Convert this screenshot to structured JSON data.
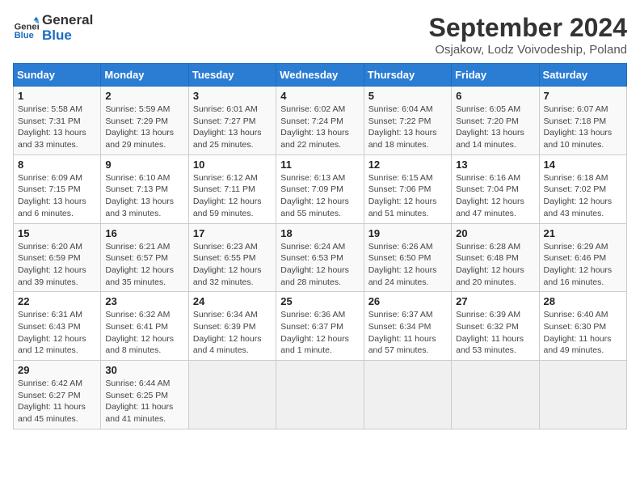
{
  "logo": {
    "text_general": "General",
    "text_blue": "Blue"
  },
  "title": "September 2024",
  "subtitle": "Osjakow, Lodz Voivodeship, Poland",
  "weekdays": [
    "Sunday",
    "Monday",
    "Tuesday",
    "Wednesday",
    "Thursday",
    "Friday",
    "Saturday"
  ],
  "weeks": [
    [
      {
        "day": "1",
        "info": "Sunrise: 5:58 AM\nSunset: 7:31 PM\nDaylight: 13 hours\nand 33 minutes."
      },
      {
        "day": "2",
        "info": "Sunrise: 5:59 AM\nSunset: 7:29 PM\nDaylight: 13 hours\nand 29 minutes."
      },
      {
        "day": "3",
        "info": "Sunrise: 6:01 AM\nSunset: 7:27 PM\nDaylight: 13 hours\nand 25 minutes."
      },
      {
        "day": "4",
        "info": "Sunrise: 6:02 AM\nSunset: 7:24 PM\nDaylight: 13 hours\nand 22 minutes."
      },
      {
        "day": "5",
        "info": "Sunrise: 6:04 AM\nSunset: 7:22 PM\nDaylight: 13 hours\nand 18 minutes."
      },
      {
        "day": "6",
        "info": "Sunrise: 6:05 AM\nSunset: 7:20 PM\nDaylight: 13 hours\nand 14 minutes."
      },
      {
        "day": "7",
        "info": "Sunrise: 6:07 AM\nSunset: 7:18 PM\nDaylight: 13 hours\nand 10 minutes."
      }
    ],
    [
      {
        "day": "8",
        "info": "Sunrise: 6:09 AM\nSunset: 7:15 PM\nDaylight: 13 hours\nand 6 minutes."
      },
      {
        "day": "9",
        "info": "Sunrise: 6:10 AM\nSunset: 7:13 PM\nDaylight: 13 hours\nand 3 minutes."
      },
      {
        "day": "10",
        "info": "Sunrise: 6:12 AM\nSunset: 7:11 PM\nDaylight: 12 hours\nand 59 minutes."
      },
      {
        "day": "11",
        "info": "Sunrise: 6:13 AM\nSunset: 7:09 PM\nDaylight: 12 hours\nand 55 minutes."
      },
      {
        "day": "12",
        "info": "Sunrise: 6:15 AM\nSunset: 7:06 PM\nDaylight: 12 hours\nand 51 minutes."
      },
      {
        "day": "13",
        "info": "Sunrise: 6:16 AM\nSunset: 7:04 PM\nDaylight: 12 hours\nand 47 minutes."
      },
      {
        "day": "14",
        "info": "Sunrise: 6:18 AM\nSunset: 7:02 PM\nDaylight: 12 hours\nand 43 minutes."
      }
    ],
    [
      {
        "day": "15",
        "info": "Sunrise: 6:20 AM\nSunset: 6:59 PM\nDaylight: 12 hours\nand 39 minutes."
      },
      {
        "day": "16",
        "info": "Sunrise: 6:21 AM\nSunset: 6:57 PM\nDaylight: 12 hours\nand 35 minutes."
      },
      {
        "day": "17",
        "info": "Sunrise: 6:23 AM\nSunset: 6:55 PM\nDaylight: 12 hours\nand 32 minutes."
      },
      {
        "day": "18",
        "info": "Sunrise: 6:24 AM\nSunset: 6:53 PM\nDaylight: 12 hours\nand 28 minutes."
      },
      {
        "day": "19",
        "info": "Sunrise: 6:26 AM\nSunset: 6:50 PM\nDaylight: 12 hours\nand 24 minutes."
      },
      {
        "day": "20",
        "info": "Sunrise: 6:28 AM\nSunset: 6:48 PM\nDaylight: 12 hours\nand 20 minutes."
      },
      {
        "day": "21",
        "info": "Sunrise: 6:29 AM\nSunset: 6:46 PM\nDaylight: 12 hours\nand 16 minutes."
      }
    ],
    [
      {
        "day": "22",
        "info": "Sunrise: 6:31 AM\nSunset: 6:43 PM\nDaylight: 12 hours\nand 12 minutes."
      },
      {
        "day": "23",
        "info": "Sunrise: 6:32 AM\nSunset: 6:41 PM\nDaylight: 12 hours\nand 8 minutes."
      },
      {
        "day": "24",
        "info": "Sunrise: 6:34 AM\nSunset: 6:39 PM\nDaylight: 12 hours\nand 4 minutes."
      },
      {
        "day": "25",
        "info": "Sunrise: 6:36 AM\nSunset: 6:37 PM\nDaylight: 12 hours\nand 1 minute."
      },
      {
        "day": "26",
        "info": "Sunrise: 6:37 AM\nSunset: 6:34 PM\nDaylight: 11 hours\nand 57 minutes."
      },
      {
        "day": "27",
        "info": "Sunrise: 6:39 AM\nSunset: 6:32 PM\nDaylight: 11 hours\nand 53 minutes."
      },
      {
        "day": "28",
        "info": "Sunrise: 6:40 AM\nSunset: 6:30 PM\nDaylight: 11 hours\nand 49 minutes."
      }
    ],
    [
      {
        "day": "29",
        "info": "Sunrise: 6:42 AM\nSunset: 6:27 PM\nDaylight: 11 hours\nand 45 minutes."
      },
      {
        "day": "30",
        "info": "Sunrise: 6:44 AM\nSunset: 6:25 PM\nDaylight: 11 hours\nand 41 minutes."
      },
      {
        "day": "",
        "info": ""
      },
      {
        "day": "",
        "info": ""
      },
      {
        "day": "",
        "info": ""
      },
      {
        "day": "",
        "info": ""
      },
      {
        "day": "",
        "info": ""
      }
    ]
  ]
}
